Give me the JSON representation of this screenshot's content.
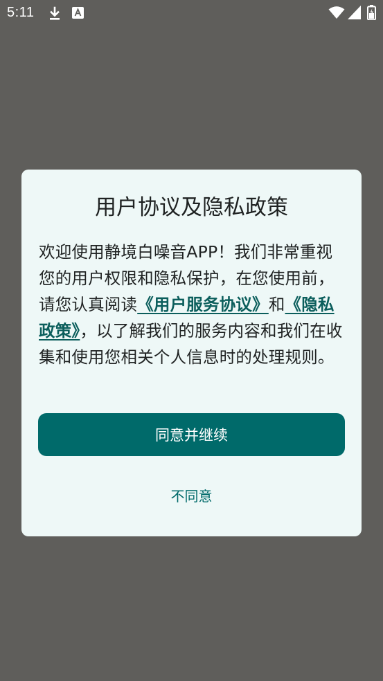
{
  "status_bar": {
    "time": "5:11",
    "icons": [
      "download-icon",
      "text-notification-icon",
      "wifi-icon",
      "cellular-signal-icon",
      "battery-icon"
    ]
  },
  "dialog": {
    "title": "用户协议及隐私政策",
    "body_part1": "欢迎使用静境白噪音APP！我们非常重视您的用户权限和隐私保护，在您使用前，请您认真阅读",
    "user_agreement_link": "《用户服务协议》",
    "body_part2": "和",
    "privacy_policy_link": "《隐私政策》",
    "body_part3": "，以了解我们的服务内容和我们在收集和使用您相关个人信息时的处理规则。",
    "agree_label": "同意并继续",
    "disagree_label": "不同意"
  },
  "colors": {
    "scrim": "#5f5e5b",
    "dialog_background": "#eef8f7",
    "accent": "#006a6a",
    "text": "#1f2222"
  }
}
